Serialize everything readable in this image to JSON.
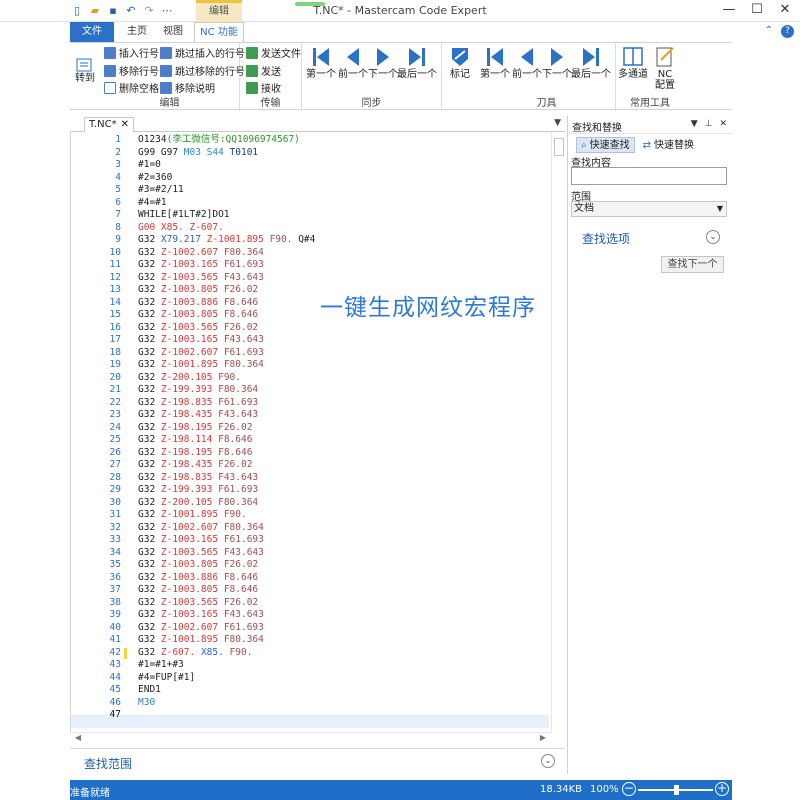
{
  "app": {
    "title": "T.NC* - Mastercam Code Expert",
    "context_tab": "编辑"
  },
  "ribbon_tabs": [
    "文件",
    "主页",
    "视图",
    "NC 功能"
  ],
  "ribbon": {
    "goto_label": "转到",
    "edit_items": [
      "插入行号",
      "跳过插入的行号",
      "移除行号",
      "跳过移除的行号",
      "删除空格",
      "移除说明"
    ],
    "edit_group": "编辑",
    "transfer_items": [
      "发送文件",
      "发送",
      "接收"
    ],
    "transfer_group": "传输",
    "sync_buttons": [
      "第一个",
      "前一个",
      "下一个",
      "最后一个"
    ],
    "sync_group": "同步",
    "mark_label": "标记",
    "tool_buttons": [
      "第一个",
      "前一个",
      "下一个",
      "最后一个"
    ],
    "tool_group": "刀具",
    "multichannel_label": "多通道",
    "nc_config_label": "NC\n配置",
    "common_group": "常用工具"
  },
  "document": {
    "tab_label": "T.NC*",
    "lines": [
      [
        [
          "O1234",
          "#222"
        ],
        [
          "(李工微信号:QQ1096974567)",
          "#2a9a2a"
        ]
      ],
      [
        [
          "G99 G97 ",
          "#222"
        ],
        [
          "M03 S44 ",
          "#2e7fd1"
        ],
        [
          "T0101",
          "#1a3d8f"
        ]
      ],
      [
        [
          "#1=0",
          "#222"
        ]
      ],
      [
        [
          "#2=360",
          "#222"
        ]
      ],
      [
        [
          "#3=#2/11",
          "#222"
        ]
      ],
      [
        [
          "#4=#1",
          "#222"
        ]
      ],
      [
        [
          "WHILE[#1LT#2]DO1",
          "#222"
        ]
      ],
      [
        [
          "G00 X85. Z-607.",
          "#d43a3a"
        ]
      ],
      [
        [
          "G32 ",
          "#222"
        ],
        [
          "X79.217 ",
          "#2e5fd1"
        ],
        [
          "Z-1001.895 ",
          "#d43a3a"
        ],
        [
          "F90. ",
          "#a05050"
        ],
        [
          "Q#4",
          "#222"
        ]
      ],
      [
        [
          "G32 ",
          "#222"
        ],
        [
          "Z-1002.607 ",
          "#d43a3a"
        ],
        [
          "F80.364",
          "#a05050"
        ]
      ],
      [
        [
          "G32 ",
          "#222"
        ],
        [
          "Z-1003.165 ",
          "#d43a3a"
        ],
        [
          "F61.693",
          "#a05050"
        ]
      ],
      [
        [
          "G32 ",
          "#222"
        ],
        [
          "Z-1003.565 ",
          "#d43a3a"
        ],
        [
          "F43.643",
          "#a05050"
        ]
      ],
      [
        [
          "G32 ",
          "#222"
        ],
        [
          "Z-1003.805 ",
          "#d43a3a"
        ],
        [
          "F26.02",
          "#a05050"
        ]
      ],
      [
        [
          "G32 ",
          "#222"
        ],
        [
          "Z-1003.886 ",
          "#d43a3a"
        ],
        [
          "F8.646",
          "#a05050"
        ]
      ],
      [
        [
          "G32 ",
          "#222"
        ],
        [
          "Z-1003.805 ",
          "#d43a3a"
        ],
        [
          "F8.646",
          "#a05050"
        ]
      ],
      [
        [
          "G32 ",
          "#222"
        ],
        [
          "Z-1003.565 ",
          "#d43a3a"
        ],
        [
          "F26.02",
          "#a05050"
        ]
      ],
      [
        [
          "G32 ",
          "#222"
        ],
        [
          "Z-1003.165 ",
          "#d43a3a"
        ],
        [
          "F43.643",
          "#a05050"
        ]
      ],
      [
        [
          "G32 ",
          "#222"
        ],
        [
          "Z-1002.607 ",
          "#d43a3a"
        ],
        [
          "F61.693",
          "#a05050"
        ]
      ],
      [
        [
          "G32 ",
          "#222"
        ],
        [
          "Z-1001.895 ",
          "#d43a3a"
        ],
        [
          "F80.364",
          "#a05050"
        ]
      ],
      [
        [
          "G32 ",
          "#222"
        ],
        [
          "Z-200.105 ",
          "#d43a3a"
        ],
        [
          "F90.",
          "#a05050"
        ]
      ],
      [
        [
          "G32 ",
          "#222"
        ],
        [
          "Z-199.393 ",
          "#d43a3a"
        ],
        [
          "F80.364",
          "#a05050"
        ]
      ],
      [
        [
          "G32 ",
          "#222"
        ],
        [
          "Z-198.835 ",
          "#d43a3a"
        ],
        [
          "F61.693",
          "#a05050"
        ]
      ],
      [
        [
          "G32 ",
          "#222"
        ],
        [
          "Z-198.435 ",
          "#d43a3a"
        ],
        [
          "F43.643",
          "#a05050"
        ]
      ],
      [
        [
          "G32 ",
          "#222"
        ],
        [
          "Z-198.195 ",
          "#d43a3a"
        ],
        [
          "F26.02",
          "#a05050"
        ]
      ],
      [
        [
          "G32 ",
          "#222"
        ],
        [
          "Z-198.114 ",
          "#d43a3a"
        ],
        [
          "F8.646",
          "#a05050"
        ]
      ],
      [
        [
          "G32 ",
          "#222"
        ],
        [
          "Z-198.195 ",
          "#d43a3a"
        ],
        [
          "F8.646",
          "#a05050"
        ]
      ],
      [
        [
          "G32 ",
          "#222"
        ],
        [
          "Z-198.435 ",
          "#d43a3a"
        ],
        [
          "F26.02",
          "#a05050"
        ]
      ],
      [
        [
          "G32 ",
          "#222"
        ],
        [
          "Z-198.835 ",
          "#d43a3a"
        ],
        [
          "F43.643",
          "#a05050"
        ]
      ],
      [
        [
          "G32 ",
          "#222"
        ],
        [
          "Z-199.393 ",
          "#d43a3a"
        ],
        [
          "F61.693",
          "#a05050"
        ]
      ],
      [
        [
          "G32 ",
          "#222"
        ],
        [
          "Z-200.105 ",
          "#d43a3a"
        ],
        [
          "F80.364",
          "#a05050"
        ]
      ],
      [
        [
          "G32 ",
          "#222"
        ],
        [
          "Z-1001.895 ",
          "#d43a3a"
        ],
        [
          "F90.",
          "#a05050"
        ]
      ],
      [
        [
          "G32 ",
          "#222"
        ],
        [
          "Z-1002.607 ",
          "#d43a3a"
        ],
        [
          "F80.364",
          "#a05050"
        ]
      ],
      [
        [
          "G32 ",
          "#222"
        ],
        [
          "Z-1003.165 ",
          "#d43a3a"
        ],
        [
          "F61.693",
          "#a05050"
        ]
      ],
      [
        [
          "G32 ",
          "#222"
        ],
        [
          "Z-1003.565 ",
          "#d43a3a"
        ],
        [
          "F43.643",
          "#a05050"
        ]
      ],
      [
        [
          "G32 ",
          "#222"
        ],
        [
          "Z-1003.805 ",
          "#d43a3a"
        ],
        [
          "F26.02",
          "#a05050"
        ]
      ],
      [
        [
          "G32 ",
          "#222"
        ],
        [
          "Z-1003.886 ",
          "#d43a3a"
        ],
        [
          "F8.646",
          "#a05050"
        ]
      ],
      [
        [
          "G32 ",
          "#222"
        ],
        [
          "Z-1003.805 ",
          "#d43a3a"
        ],
        [
          "F8.646",
          "#a05050"
        ]
      ],
      [
        [
          "G32 ",
          "#222"
        ],
        [
          "Z-1003.565 ",
          "#d43a3a"
        ],
        [
          "F26.02",
          "#a05050"
        ]
      ],
      [
        [
          "G32 ",
          "#222"
        ],
        [
          "Z-1003.165 ",
          "#d43a3a"
        ],
        [
          "F43.643",
          "#a05050"
        ]
      ],
      [
        [
          "G32 ",
          "#222"
        ],
        [
          "Z-1002.607 ",
          "#d43a3a"
        ],
        [
          "F61.693",
          "#a05050"
        ]
      ],
      [
        [
          "G32 ",
          "#222"
        ],
        [
          "Z-1001.895 ",
          "#d43a3a"
        ],
        [
          "F80.364",
          "#a05050"
        ]
      ],
      [
        [
          "G32 ",
          "#222"
        ],
        [
          "Z-607. ",
          "#d43a3a"
        ],
        [
          "X85. ",
          "#2e5fd1"
        ],
        [
          "F90.",
          "#a05050"
        ]
      ],
      [
        [
          "#1=#1+#3",
          "#222"
        ]
      ],
      [
        [
          "#4=FUP[#1]",
          "#222"
        ]
      ],
      [
        [
          "END1",
          "#222"
        ]
      ],
      [
        [
          "M30",
          "#2e7fd1"
        ]
      ],
      [
        [
          "",
          "#222"
        ]
      ]
    ],
    "current_line": 47,
    "changed_line": 42
  },
  "overlay_text": "一键生成网纹宏程序",
  "find_scope_label": "查找范围",
  "panel": {
    "title": "查找和替换",
    "tab_quick_find": "快速查找",
    "tab_quick_replace": "快速替换",
    "find_label": "查找内容",
    "find_value": "",
    "scope_label": "范围",
    "scope_value": "文档",
    "options_label": "查找选项",
    "find_next": "查找下一个"
  },
  "status": {
    "ready": "准备就绪",
    "file_size": "18.34KB",
    "zoom": "100%",
    "zoom_level_percent": 100
  },
  "colors": {
    "accent": "#2b70c9",
    "status_bar": "#1f6fc8"
  }
}
